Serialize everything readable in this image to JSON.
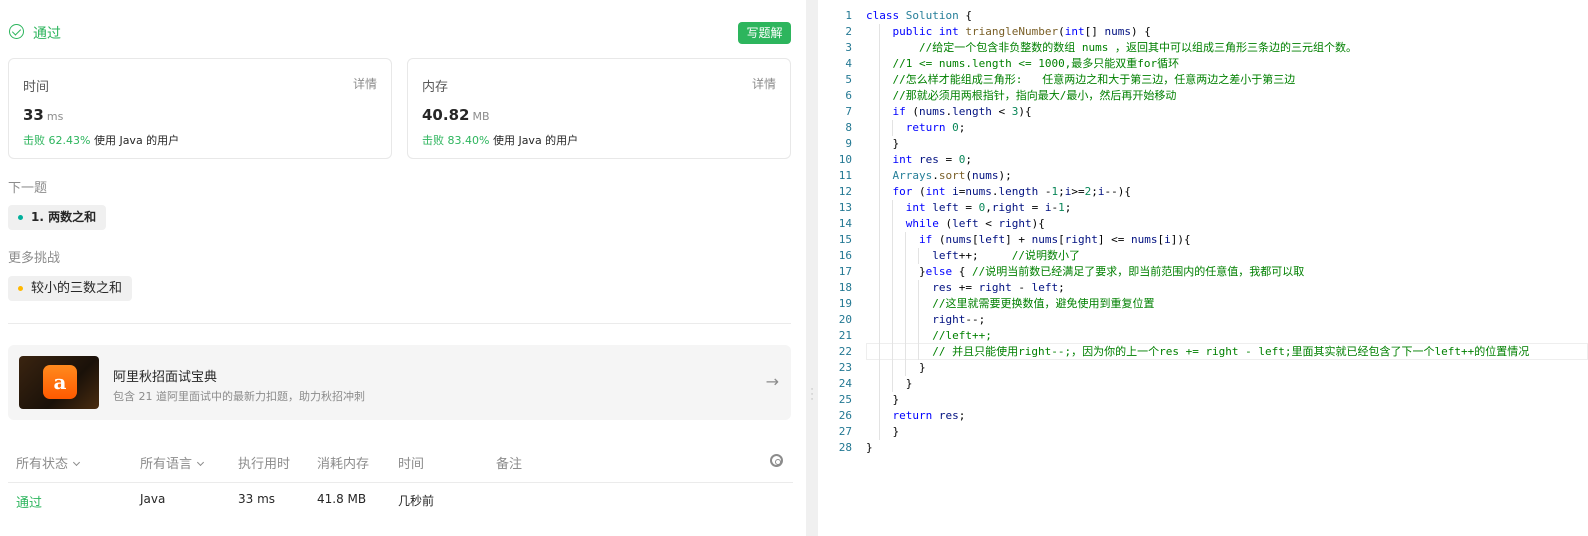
{
  "result": {
    "status": "通过",
    "write_solution_label": "写题解"
  },
  "runtime_card": {
    "title": "时间",
    "detail": "详情",
    "value": "33",
    "unit": "ms",
    "beat_prefix": "击败",
    "beat_pct": "62.43%",
    "beat_suffix": "使用 Java 的用户"
  },
  "memory_card": {
    "title": "内存",
    "detail": "详情",
    "value": "40.82",
    "unit": "MB",
    "beat_prefix": "击败",
    "beat_pct": "83.40%",
    "beat_suffix": "使用 Java 的用户"
  },
  "next_problem": {
    "label": "下一题",
    "item": "1. 两数之和"
  },
  "more_challenges": {
    "label": "更多挑战",
    "item": "较小的三数之和"
  },
  "banner": {
    "logo_glyph": "a",
    "title": "阿里秋招面试宝典",
    "subtitle": "包含 21 道阿里面试中的最新力扣题，助力秋招冲刺",
    "arrow": "→"
  },
  "submissions_table": {
    "headers": {
      "status": "所有状态",
      "language": "所有语言",
      "runtime": "执行用时",
      "memory": "消耗内存",
      "time": "时间",
      "notes": "备注"
    },
    "rows": [
      {
        "status": "通过",
        "language": "Java",
        "runtime": "33 ms",
        "memory": "41.8 MB",
        "time": "几秒前",
        "notes": ""
      }
    ]
  },
  "editor": {
    "lines": [
      "class Solution {",
      "    public int triangleNumber(int[] nums) {",
      "        //给定一个包含非负整数的数组 nums ，返回其中可以组成三角形三条边的三元组个数。",
      "    //1 <= nums.length <= 1000,最多只能双重for循环",
      "    //怎么样才能组成三角形:   任意两边之和大于第三边，任意两边之差小于第三边",
      "    //那就必须用两根指针，指向最大/最小，然后再开始移动",
      "    if (nums.length < 3){",
      "      return 0;",
      "    }",
      "    int res = 0;",
      "    Arrays.sort(nums);",
      "    for (int i=nums.length -1;i>=2;i--){",
      "      int left = 0,right = i-1;",
      "      while (left < right){",
      "        if (nums[left] + nums[right] <= nums[i]){",
      "          left++;     //说明数小了",
      "        }else { //说明当前数已经满足了要求，即当前范围内的任意值，我都可以取",
      "          res += right - left;",
      "          //这里就需要更换数值，避免使用到重复位置",
      "          right--;",
      "          //left++;",
      "          // 并且只能使用right--;，因为你的上一个res += right - left;里面其实就已经包含了下一个left++的位置情况",
      "        }",
      "      }",
      "    }",
      "    return res;",
      "    }",
      "}"
    ]
  }
}
